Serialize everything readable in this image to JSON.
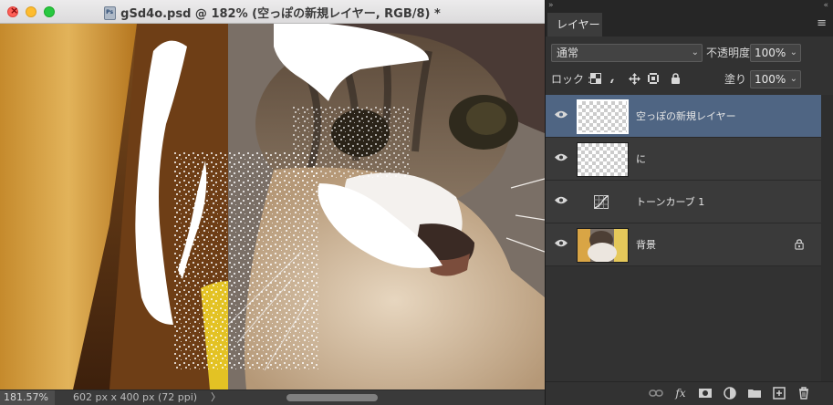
{
  "document": {
    "title": "gSd4o.psd @ 182% (空っぽの新規レイヤー, RGB/8) *",
    "zoom": "181.57%",
    "info": "602 px x 400 px (72 ppi)",
    "info_arrow": "〉"
  },
  "panel": {
    "collapse_glyph": "«",
    "close_glyph": "»",
    "tab": "レイヤー",
    "menu_glyph": "≡",
    "blend_mode": "通常",
    "opacity_label": "不透明度 :",
    "opacity_value": "100%",
    "lock_label": "ロック :",
    "fill_label": "塗り :",
    "fill_value": "100%",
    "chevron": "⌄",
    "layers": [
      {
        "name": "空っぽの新規レイヤー",
        "visible": true,
        "selected": true,
        "kind": "empty"
      },
      {
        "name": "に",
        "visible": true,
        "selected": false,
        "kind": "empty"
      },
      {
        "name": "トーンカーブ 1",
        "visible": true,
        "selected": false,
        "kind": "adjustment"
      },
      {
        "name": "背景",
        "visible": true,
        "selected": false,
        "kind": "image",
        "locked": true
      }
    ],
    "bottom_icons": [
      "link-icon",
      "fx-icon",
      "mask-icon",
      "adjustment-icon",
      "folder-icon",
      "new-layer-icon",
      "trash-icon"
    ],
    "fx_label": "fx"
  }
}
